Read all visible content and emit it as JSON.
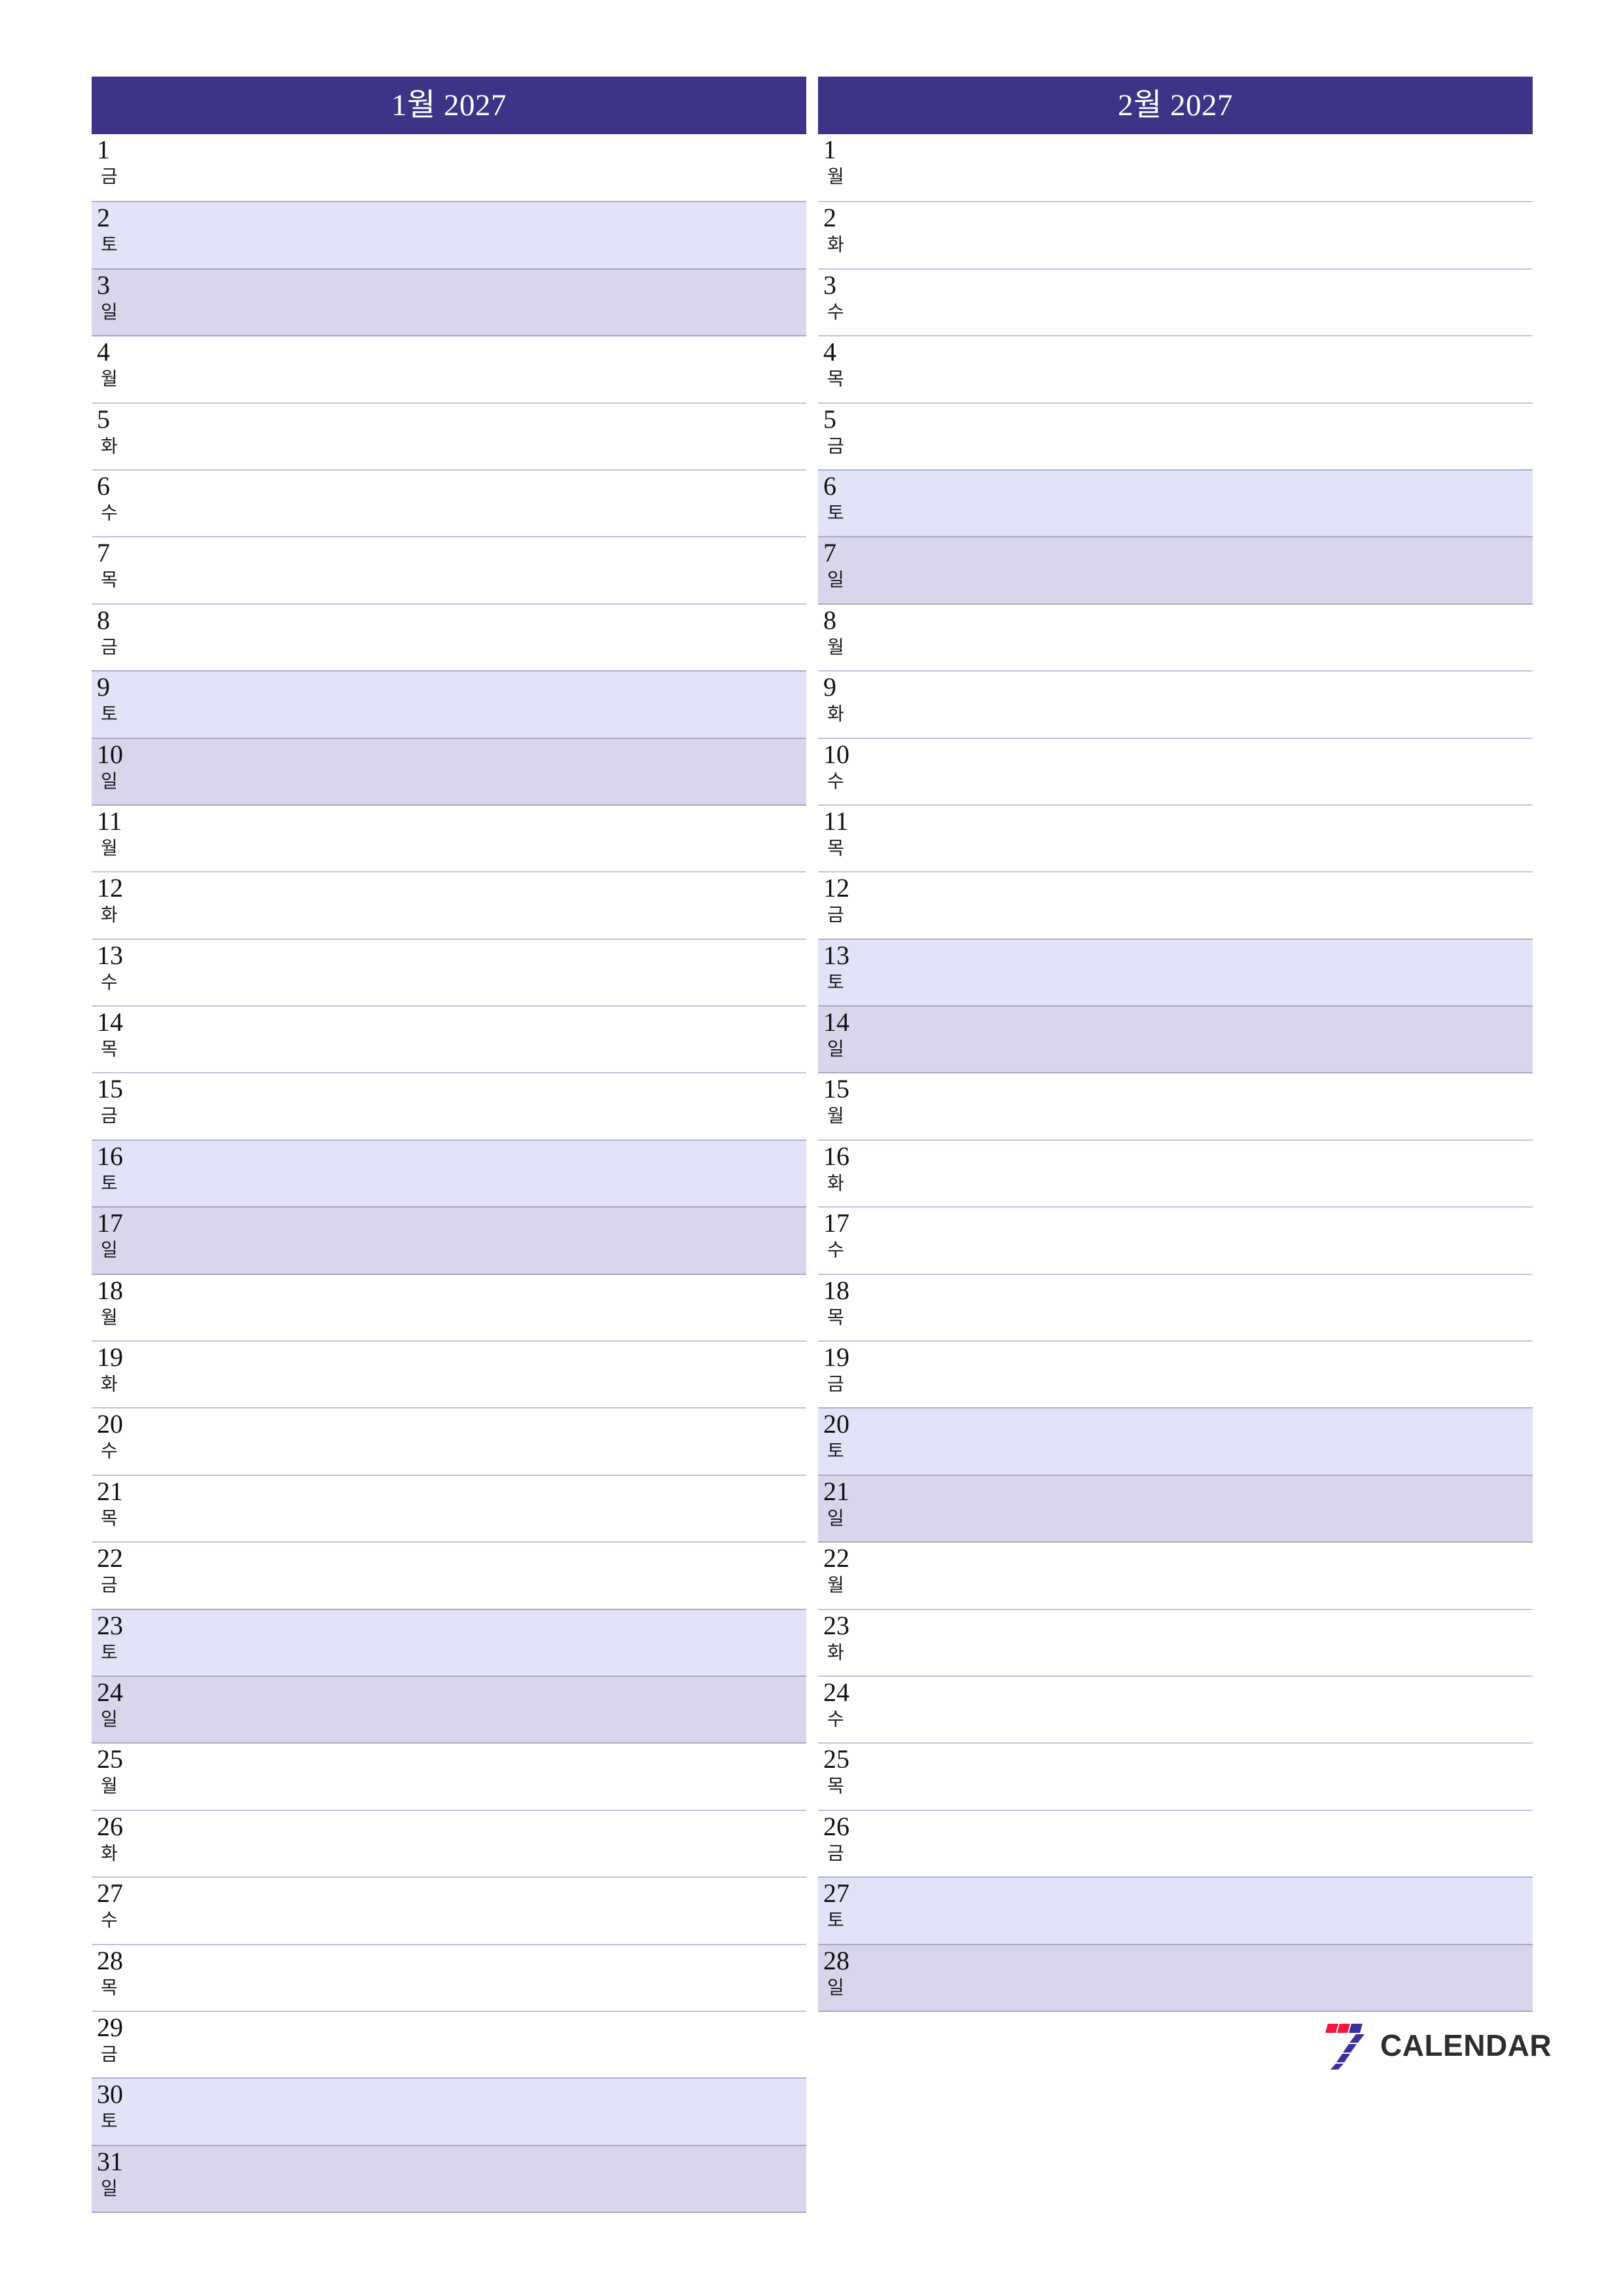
{
  "theme": {
    "header_bg": "#3d3488",
    "header_text": "#ffffff",
    "saturday_bg": "#e2e3f6",
    "sunday_bg": "#d9d6ec",
    "row_rule": "#c3c1dc",
    "page_bg": "#ffffff",
    "logo_red": "#f4163f",
    "logo_blue": "#3d2f9e",
    "logo_text": "#2e2e2e"
  },
  "brand": {
    "name": "CALENDAR",
    "mark": "seven-logo-icon"
  },
  "months": [
    {
      "key": "january",
      "title": "1월 2027",
      "days": [
        {
          "num": "1",
          "dow": "금",
          "kind": "weekday"
        },
        {
          "num": "2",
          "dow": "토",
          "kind": "sat"
        },
        {
          "num": "3",
          "dow": "일",
          "kind": "sun"
        },
        {
          "num": "4",
          "dow": "월",
          "kind": "weekday"
        },
        {
          "num": "5",
          "dow": "화",
          "kind": "weekday"
        },
        {
          "num": "6",
          "dow": "수",
          "kind": "weekday"
        },
        {
          "num": "7",
          "dow": "목",
          "kind": "weekday"
        },
        {
          "num": "8",
          "dow": "금",
          "kind": "weekday"
        },
        {
          "num": "9",
          "dow": "토",
          "kind": "sat"
        },
        {
          "num": "10",
          "dow": "일",
          "kind": "sun"
        },
        {
          "num": "11",
          "dow": "월",
          "kind": "weekday"
        },
        {
          "num": "12",
          "dow": "화",
          "kind": "weekday"
        },
        {
          "num": "13",
          "dow": "수",
          "kind": "weekday"
        },
        {
          "num": "14",
          "dow": "목",
          "kind": "weekday"
        },
        {
          "num": "15",
          "dow": "금",
          "kind": "weekday"
        },
        {
          "num": "16",
          "dow": "토",
          "kind": "sat"
        },
        {
          "num": "17",
          "dow": "일",
          "kind": "sun"
        },
        {
          "num": "18",
          "dow": "월",
          "kind": "weekday"
        },
        {
          "num": "19",
          "dow": "화",
          "kind": "weekday"
        },
        {
          "num": "20",
          "dow": "수",
          "kind": "weekday"
        },
        {
          "num": "21",
          "dow": "목",
          "kind": "weekday"
        },
        {
          "num": "22",
          "dow": "금",
          "kind": "weekday"
        },
        {
          "num": "23",
          "dow": "토",
          "kind": "sat"
        },
        {
          "num": "24",
          "dow": "일",
          "kind": "sun"
        },
        {
          "num": "25",
          "dow": "월",
          "kind": "weekday"
        },
        {
          "num": "26",
          "dow": "화",
          "kind": "weekday"
        },
        {
          "num": "27",
          "dow": "수",
          "kind": "weekday"
        },
        {
          "num": "28",
          "dow": "목",
          "kind": "weekday"
        },
        {
          "num": "29",
          "dow": "금",
          "kind": "weekday"
        },
        {
          "num": "30",
          "dow": "토",
          "kind": "sat"
        },
        {
          "num": "31",
          "dow": "일",
          "kind": "sun"
        }
      ]
    },
    {
      "key": "february",
      "title": "2월 2027",
      "days": [
        {
          "num": "1",
          "dow": "월",
          "kind": "weekday"
        },
        {
          "num": "2",
          "dow": "화",
          "kind": "weekday"
        },
        {
          "num": "3",
          "dow": "수",
          "kind": "weekday"
        },
        {
          "num": "4",
          "dow": "목",
          "kind": "weekday"
        },
        {
          "num": "5",
          "dow": "금",
          "kind": "weekday"
        },
        {
          "num": "6",
          "dow": "토",
          "kind": "sat"
        },
        {
          "num": "7",
          "dow": "일",
          "kind": "sun"
        },
        {
          "num": "8",
          "dow": "월",
          "kind": "weekday"
        },
        {
          "num": "9",
          "dow": "화",
          "kind": "weekday"
        },
        {
          "num": "10",
          "dow": "수",
          "kind": "weekday"
        },
        {
          "num": "11",
          "dow": "목",
          "kind": "weekday"
        },
        {
          "num": "12",
          "dow": "금",
          "kind": "weekday"
        },
        {
          "num": "13",
          "dow": "토",
          "kind": "sat"
        },
        {
          "num": "14",
          "dow": "일",
          "kind": "sun"
        },
        {
          "num": "15",
          "dow": "월",
          "kind": "weekday"
        },
        {
          "num": "16",
          "dow": "화",
          "kind": "weekday"
        },
        {
          "num": "17",
          "dow": "수",
          "kind": "weekday"
        },
        {
          "num": "18",
          "dow": "목",
          "kind": "weekday"
        },
        {
          "num": "19",
          "dow": "금",
          "kind": "weekday"
        },
        {
          "num": "20",
          "dow": "토",
          "kind": "sat"
        },
        {
          "num": "21",
          "dow": "일",
          "kind": "sun"
        },
        {
          "num": "22",
          "dow": "월",
          "kind": "weekday"
        },
        {
          "num": "23",
          "dow": "화",
          "kind": "weekday"
        },
        {
          "num": "24",
          "dow": "수",
          "kind": "weekday"
        },
        {
          "num": "25",
          "dow": "목",
          "kind": "weekday"
        },
        {
          "num": "26",
          "dow": "금",
          "kind": "weekday"
        },
        {
          "num": "27",
          "dow": "토",
          "kind": "sat"
        },
        {
          "num": "28",
          "dow": "일",
          "kind": "sun"
        }
      ]
    }
  ]
}
